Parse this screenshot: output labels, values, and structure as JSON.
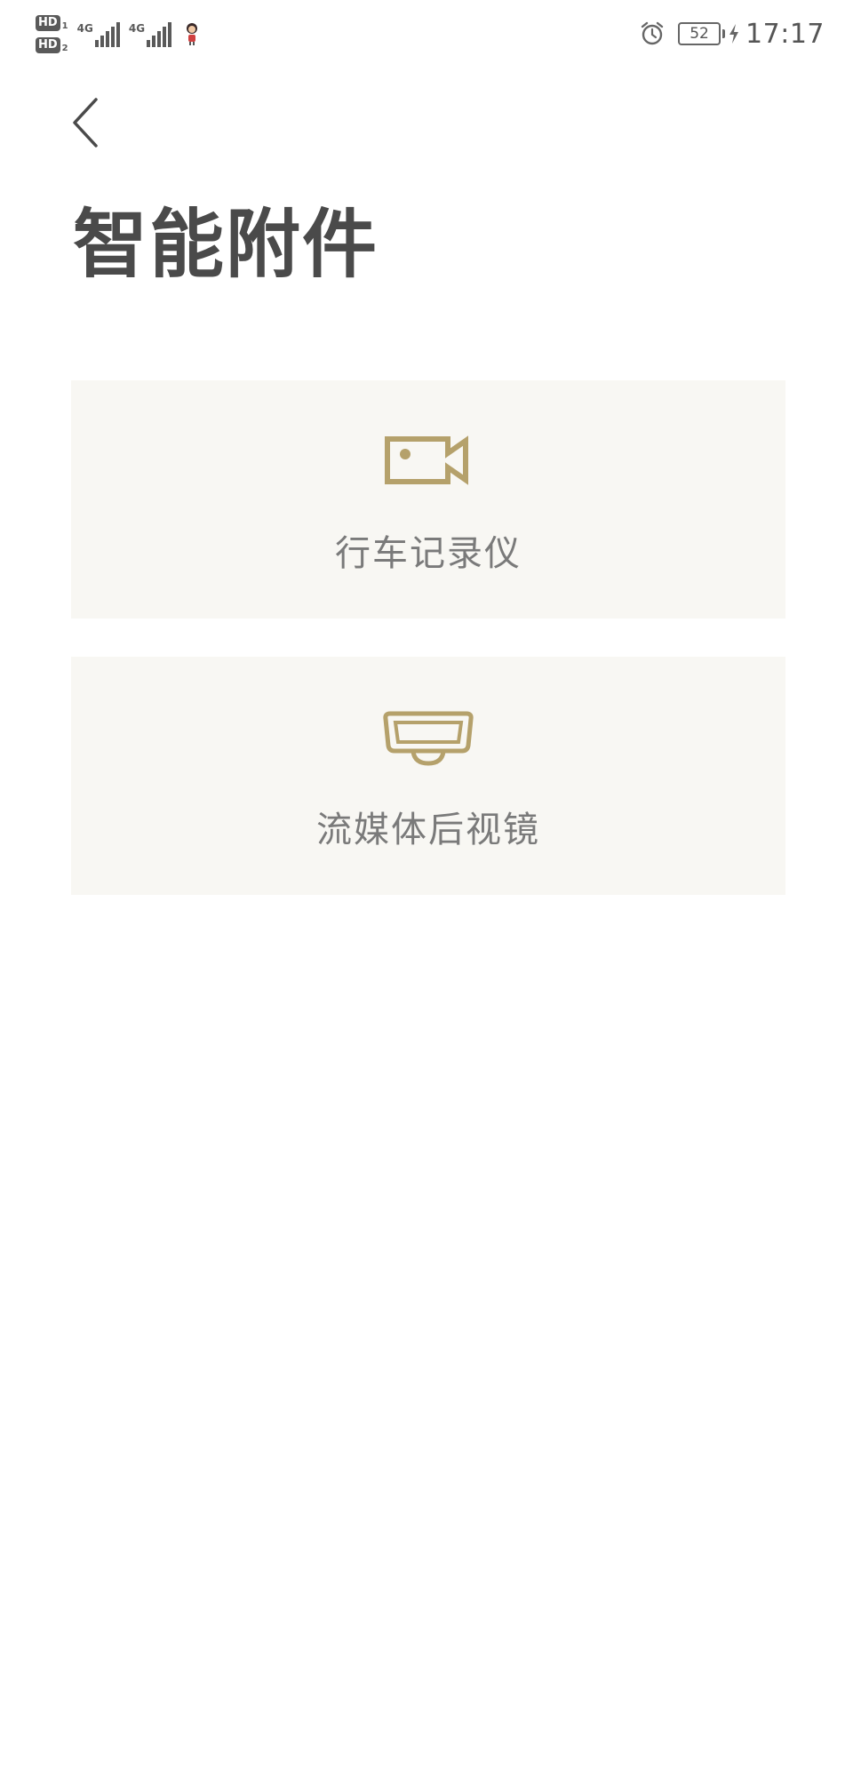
{
  "status_bar": {
    "sim1_label": "HD",
    "sim1_index": "1",
    "sim2_label": "HD",
    "sim2_index": "2",
    "network1_type": "4G",
    "network2_type": "4G",
    "battery_level": "52",
    "time": "17:17"
  },
  "header": {
    "back_icon": "chevron-left-icon",
    "title": "智能附件"
  },
  "accessories": [
    {
      "icon": "video-camera-icon",
      "label": "行车记录仪"
    },
    {
      "icon": "rearview-mirror-icon",
      "label": "流媒体后视镜"
    }
  ],
  "colors": {
    "accent": "#b5a16b",
    "card_background": "#f8f7f3",
    "title_text": "#4a4a4a",
    "label_text": "#7a7a7a"
  }
}
